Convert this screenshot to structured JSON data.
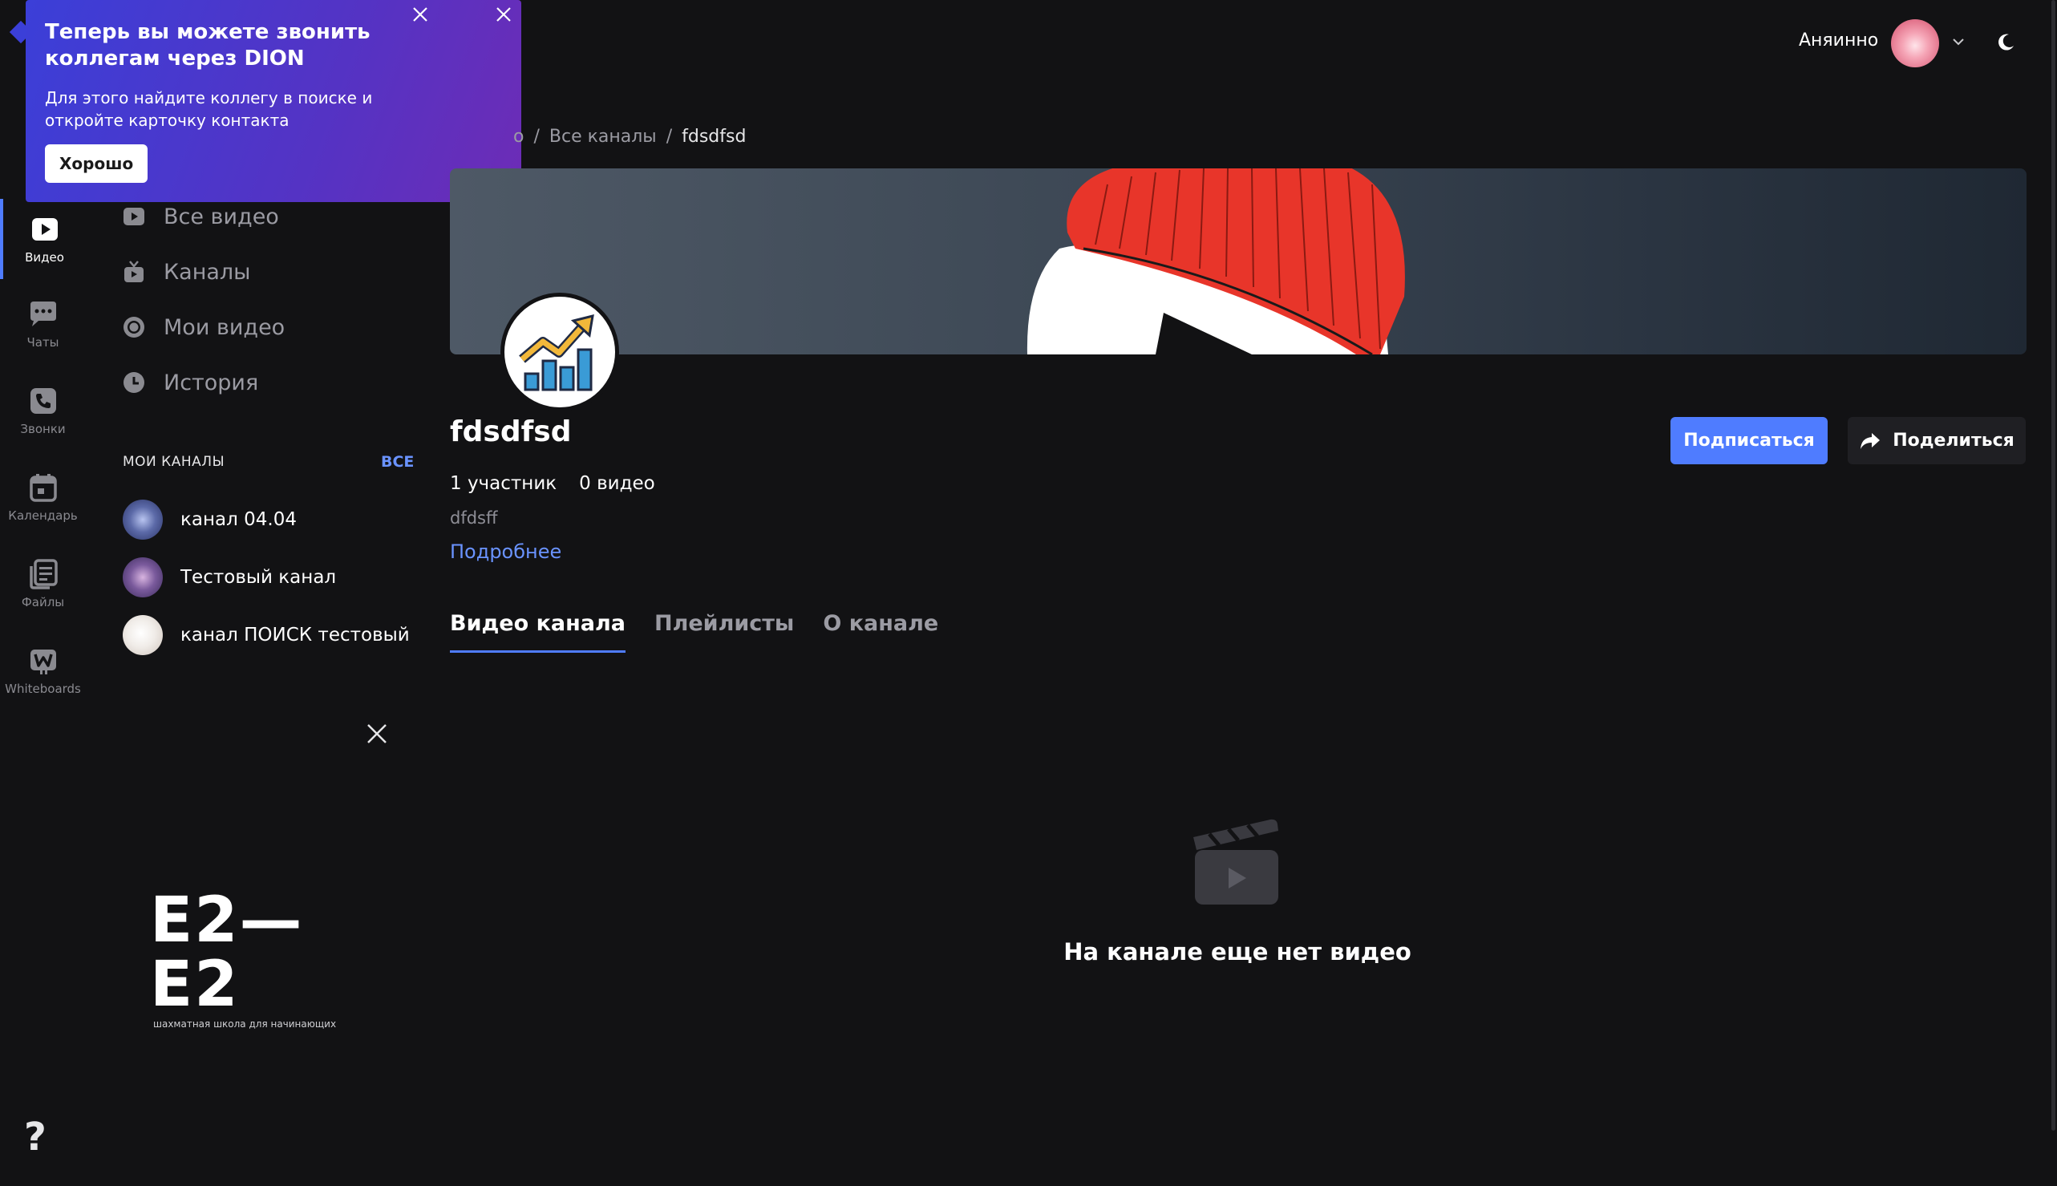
{
  "rail": {
    "items": [
      {
        "label": "Видео",
        "icon": "video-icon",
        "active": true
      },
      {
        "label": "Чаты",
        "icon": "chat-icon"
      },
      {
        "label": "Звонки",
        "icon": "phone-icon"
      },
      {
        "label": "Календарь",
        "icon": "calendar-icon"
      },
      {
        "label": "Файлы",
        "icon": "files-icon"
      },
      {
        "label": "Whiteboards",
        "icon": "whiteboard-icon"
      }
    ],
    "help": "?"
  },
  "sidebar": {
    "nav": [
      {
        "label": "Все видео",
        "icon": "play-icon"
      },
      {
        "label": "Каналы",
        "icon": "tv-icon"
      },
      {
        "label": "Мои видео",
        "icon": "record-icon"
      },
      {
        "label": "История",
        "icon": "clock-icon"
      }
    ],
    "my_channels_title": "МОИ КАНАЛЫ",
    "all_link": "ВСЕ",
    "channels": [
      {
        "name": "канал 04.04"
      },
      {
        "name": "Тестовый канал"
      },
      {
        "name": "канал ПОИСК тестовый"
      }
    ],
    "promo": {
      "logo_big": "E2—E2",
      "logo_small": "шахматная школа для начинающих"
    }
  },
  "toast": {
    "title": "Теперь вы можете звонить коллегам через DION",
    "text": "Для этого найдите коллегу в поиске и откройте карточку контакта",
    "ok_label": "Хорошо"
  },
  "header": {
    "user_name": "Аняинно"
  },
  "breadcrumb": {
    "items": [
      "о",
      "Все каналы",
      "fdsdfsd"
    ],
    "separator": "/"
  },
  "channel": {
    "title": "fdsdfsd",
    "members": "1 участник",
    "videos": "0 видео",
    "description": "dfdsff",
    "more_link": "Подробнее",
    "subscribe_label": "Подписаться",
    "share_label": "Поделиться",
    "tabs": [
      {
        "label": "Видео канала",
        "active": true
      },
      {
        "label": "Плейлисты"
      },
      {
        "label": "О канале"
      }
    ],
    "empty_text": "На канале еще нет видео"
  },
  "colors": {
    "accent": "#4f7cff",
    "link": "#6a93ff",
    "background": "#121214"
  }
}
